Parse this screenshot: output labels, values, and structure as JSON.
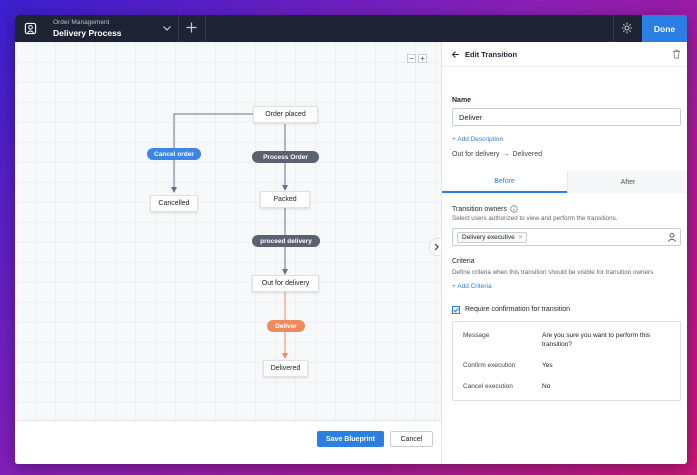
{
  "topbar": {
    "subtitle": "Order Management",
    "title": "Delivery Process",
    "done_label": "Done"
  },
  "canvas": {
    "zoom_out": "−",
    "zoom_in": "+",
    "nodes": {
      "order_placed": "Order placed",
      "cancelled": "Cancelled",
      "packed": "Packed",
      "out_for_delivery": "Out for delivery",
      "delivered": "Delivered"
    },
    "transitions": {
      "cancel_order": "Cancel order",
      "process_order": "Process Order",
      "proceed_delivery": "proceed delivery",
      "deliver": "Deliver"
    },
    "save_label": "Save Blueprint",
    "cancel_label": "Cancel"
  },
  "colors": {
    "accent": "#2b7fe3",
    "topbar": "#1e2433",
    "pill_blue": "#3d86e6",
    "pill_dark": "#5b6170",
    "pill_orange": "#f08a5d"
  },
  "panel": {
    "title": "Edit Transition",
    "name_label": "Name",
    "name_value": "Deliver",
    "add_description": "+ Add Description",
    "flow_from": "Out for delivery",
    "flow_arrow": "→",
    "flow_to": "Delivered",
    "tabs": [
      "Before",
      "After"
    ],
    "owners_label": "Transition owners",
    "owners_desc": "Select users authorized to view and  perform the transitions.",
    "owner_chip": "Delivery executive",
    "owner_chip_remove": "×",
    "criteria_label": "Criteria",
    "criteria_desc": "Define criteria when this transition should be visible for transition owners",
    "add_criteria": "+ Add Criteria",
    "require_confirmation": "Require confirmation for transition",
    "confirmation": {
      "message_key": "Message",
      "message_value": "Are you sure you want to perform this transition?",
      "confirm_key": "Confirm execution",
      "confirm_value": "Yes",
      "cancel_key": "Cancel execution",
      "cancel_value": "No"
    }
  }
}
